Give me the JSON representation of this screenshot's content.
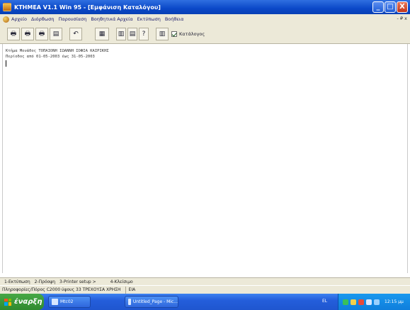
{
  "window": {
    "title": "KTHMEA   V1.1 Win 95 - [Εμφάνιση Καταλόγου]",
    "minimize_glyph": "_",
    "maximize_glyph": "□",
    "close_glyph": "X"
  },
  "menu": {
    "items": [
      "Αρχείο",
      "Διόρθωση",
      "Παρουσίαση",
      "Βοηθητικά Αρχεία",
      "Εκτύπωση",
      "Βοήθεια"
    ],
    "right": "- ₽ x"
  },
  "toolbar": {
    "checkbox_label": "Κατάλογος",
    "checkbox_checked": true,
    "glyphs": [
      "🖶",
      "🖶",
      "🖶",
      "▤",
      "↶",
      "▦",
      "▥",
      "▤",
      "?",
      "▥"
    ]
  },
  "document": {
    "lines": [
      "Κτήμα Μονάδος ΤΟΠΑΙΟΝΗ ΙΩΑΝΝΗ ΣΟΦΙΑ ΚΑΙΡΙΚΗΣ",
      "Περίοδος από 01-05-2003 έως 31-05-2003"
    ]
  },
  "function_keys": [
    "1-Εκτύπωση",
    "2-Πρόοψη",
    "3-Printer setup >",
    "4-Κλείσιμο"
  ],
  "status": {
    "main": "Πληροφορίες/Πόρος C2000 ύψους 33 ΤΡΕΧΟΥΣΑ ΧΡΗΣΗ",
    "mode": "ΕΙΑ"
  },
  "taskbar": {
    "start_label": "έναρξη",
    "tasks": [
      "Mtc02",
      "Untitled_Page - Mic..."
    ],
    "language": "EL",
    "clock": "12:15 μμ"
  },
  "colors": {
    "titlebar": "#0a48c8",
    "taskbar": "#245edb",
    "start_button": "#47a846",
    "chrome": "#ece9d8"
  }
}
